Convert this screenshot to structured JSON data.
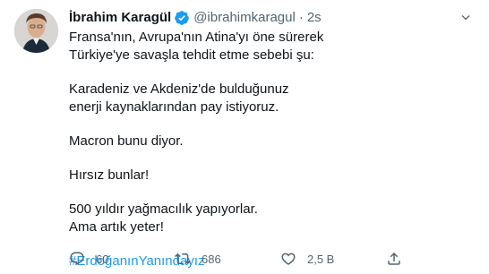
{
  "tweet": {
    "author_name": "İbrahim Karagül",
    "handle": "@ibrahimkaragul",
    "separator": "·",
    "time": "2s",
    "paragraphs": [
      [
        "Fransa'nın, Avrupa'nın Atina'yı öne sürerek",
        "Türkiye'ye savaşla tehdit etme sebebi şu:"
      ],
      [
        "Karadeniz ve Akdeniz'de bulduğunuz",
        "enerji kaynaklarından pay istiyoruz."
      ],
      [
        "Macron bunu diyor."
      ],
      [
        "Hırsız bunlar!"
      ],
      [
        "500 yıldır yağmacılık yapıyorlar.",
        "Ama artık yeter!"
      ]
    ],
    "hashtag": "#ErdoğanınYanındayız"
  },
  "actions": {
    "reply_count": "60",
    "retweet_count": "686",
    "like_count": "2,5 B"
  },
  "icons": {
    "verified": "verified-badge-icon",
    "caret": "chevron-down-icon",
    "reply": "reply-icon",
    "retweet": "retweet-icon",
    "like": "heart-icon",
    "share": "share-icon"
  },
  "colors": {
    "accent": "#1d9bf0",
    "secondary_text": "#536471",
    "primary_text": "#0f1419"
  }
}
